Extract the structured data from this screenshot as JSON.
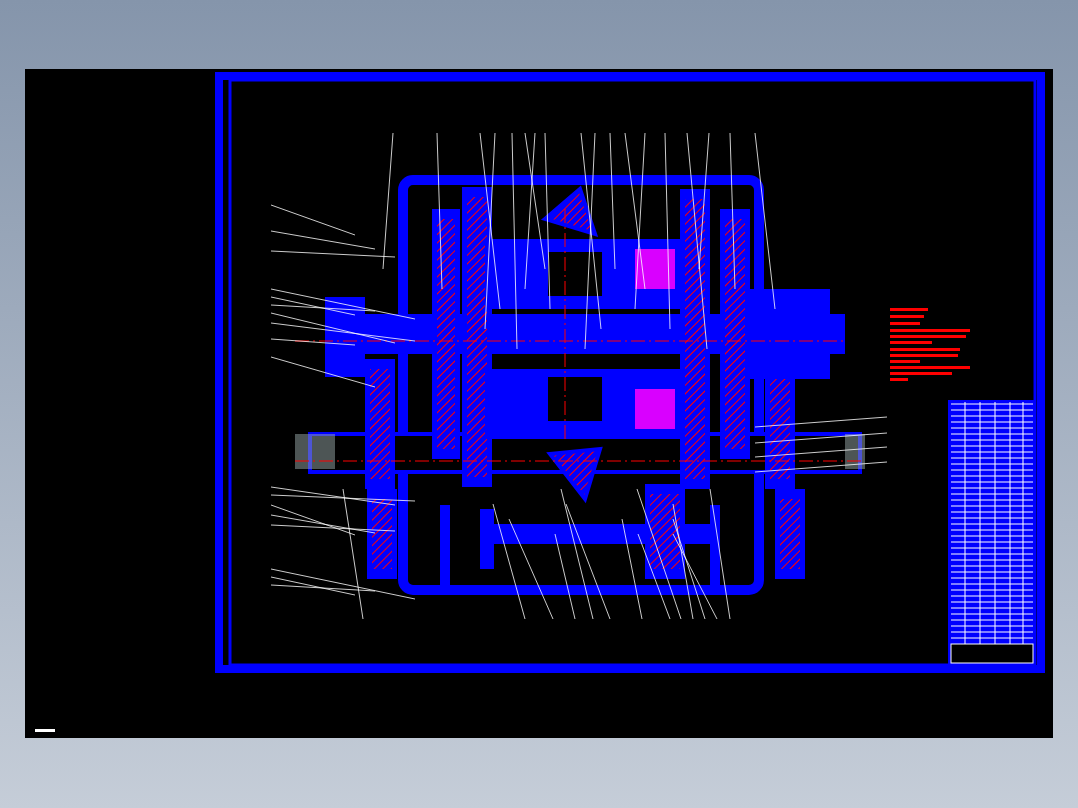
{
  "sheet": {
    "kind": "assembly"
  }
}
